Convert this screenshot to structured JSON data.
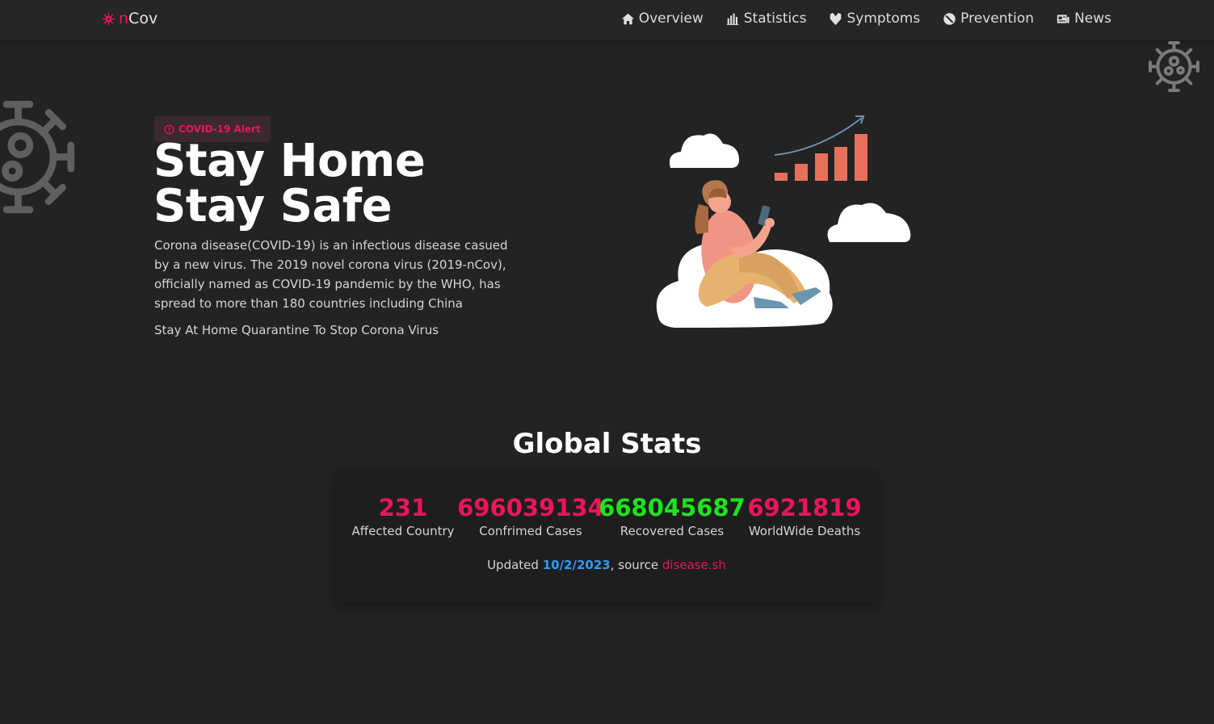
{
  "brand": {
    "part1": "n",
    "part2": "Cov",
    "icon": "virus-icon",
    "color": "#f0145a"
  },
  "nav": {
    "items": [
      {
        "label": "Overview",
        "icon": "home-icon"
      },
      {
        "label": "Statistics",
        "icon": "bar-chart-icon"
      },
      {
        "label": "Symptoms",
        "icon": "symptoms-icon"
      },
      {
        "label": "Prevention",
        "icon": "prevention-icon"
      },
      {
        "label": "News",
        "icon": "news-icon"
      }
    ]
  },
  "hero": {
    "badge": "COVID-19 Alert",
    "title_line1": "Stay Home",
    "title_line2": "Stay Safe",
    "description": "Corona disease(COVID-19) is an infectious disease casued by a new virus. The 2019 novel corona virus (2019-nCov), officially named as COVID-19 pandemic by the WHO, has spread to more than 180 countries including China",
    "tagline": "Stay At Home Quarantine To Stop Corona Virus"
  },
  "stats": {
    "title": "Global Stats",
    "items": [
      {
        "value": "231",
        "label": "Affected Country",
        "color": "#f0145a"
      },
      {
        "value": "696039134",
        "label": "Confrimed Cases",
        "color": "#f0145a"
      },
      {
        "value": "668045687",
        "label": "Recovered Cases",
        "color": "#1ee31e"
      },
      {
        "value": "6921819",
        "label": "WorldWide Deaths",
        "color": "#f0145a"
      }
    ],
    "updated_prefix": "Updated ",
    "updated_date": "10/2/2023",
    "source_prefix": ", source ",
    "source_link": "disease.sh"
  },
  "colors": {
    "accent": "#f0145a",
    "recovered": "#1ee31e",
    "date": "#2f9bff",
    "background": "#232323"
  }
}
